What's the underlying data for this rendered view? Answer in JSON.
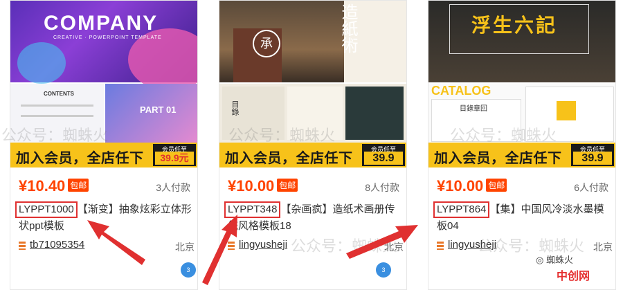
{
  "banner": {
    "text": "加入会员，全店任下",
    "small": "会员低至"
  },
  "cards": [
    {
      "banner_price": "39.9元",
      "cover_title": "COMPANY",
      "cover_sub": "CREATIVE · POWERPOINT TEMPLATE",
      "thumb1_title": "CONTENTS",
      "thumb2_title": "PART 01",
      "price": "¥10.40",
      "badge": "包邮",
      "buyers": "3人付款",
      "code": "LYPPT1000",
      "title_rest": "【渐变】抽象炫彩立体形状ppt模板",
      "seller": "tb71095354",
      "city": "北京"
    },
    {
      "banner_price": "39.9",
      "cover_title": "造紙術",
      "cover_seal": "承",
      "thumb1_title": "目錄",
      "price": "¥10.00",
      "badge": "包邮",
      "buyers": "8人付款",
      "code": "LYPPT348",
      "title_rest": "【杂画疯】造纸术画册传统风格模板18",
      "seller": "lingyusheji",
      "city": "北京"
    },
    {
      "banner_price": "39.9",
      "cover_title": "浮生六記",
      "thumb_title": "CATALOG",
      "thumb1_title": "目錄章回",
      "price": "¥10.00",
      "badge": "包邮",
      "buyers": "6人付款",
      "code": "LYPPT864",
      "title_rest": "【集】中国风冷淡水墨模板04",
      "seller": "lingyusheji",
      "city": "北京"
    }
  ],
  "watermark": "公众号：蜘蛛火",
  "bubble_text": "3",
  "corner": {
    "wechat": "蜘蛛火",
    "site": "中创网"
  },
  "colors": {
    "accent": "#ff4400",
    "highlight": "#e03030",
    "banner": "#f7c21a"
  }
}
